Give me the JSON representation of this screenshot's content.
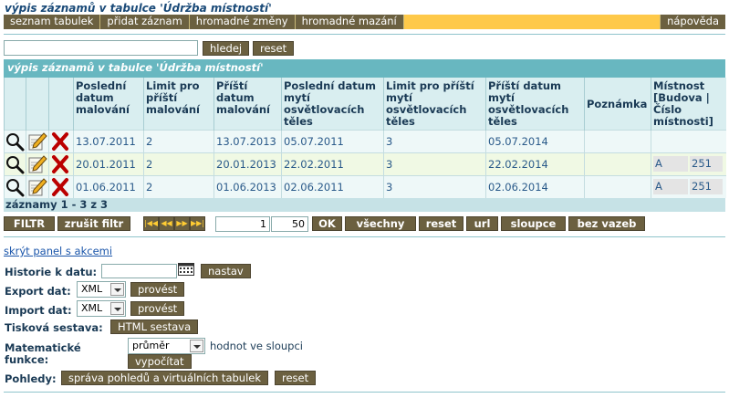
{
  "page_title": "výpis záznamů v tabulce 'Údržba místností'",
  "topbar": {
    "items": [
      "seznam tabulek",
      "přidat záznam",
      "hromadné změny",
      "hromadné mazání"
    ],
    "help": "nápověda"
  },
  "search": {
    "value": "",
    "button": "hledej",
    "reset": "reset"
  },
  "panel_title": "výpis záznamů v tabulce 'Údržba místností'",
  "table": {
    "headers": [
      "Poslední datum malování",
      "Limit pro příští malování",
      "Příští datum malování",
      "Poslední datum mytí osvětlovacích těles",
      "Limit pro příští mytí osvětlovacích těles",
      "Příští datum mytí osvětlovacích těles",
      "Poznámka",
      "Místnost [Budova | Číslo místnosti]"
    ],
    "rows": [
      [
        "13.07.2011",
        "2",
        "13.07.2013",
        "05.07.2011",
        "3",
        "05.07.2014",
        "",
        "",
        ""
      ],
      [
        "20.01.2011",
        "2",
        "20.01.2013",
        "22.02.2011",
        "3",
        "22.02.2014",
        "",
        "A",
        "251"
      ],
      [
        "01.06.2011",
        "2",
        "01.06.2013",
        "02.06.2011",
        "3",
        "02.06.2014",
        "",
        "A",
        "251"
      ]
    ],
    "records": "záznamy 1 - 3 z 3"
  },
  "icons": {
    "view": "magnifier-icon",
    "edit": "pencil-icon",
    "delete": "red-x-icon"
  },
  "toolbar": {
    "filter": "FILTR",
    "clear_filter": "zrušit filtr",
    "page_from": "1",
    "page_size": "50",
    "ok": "OK",
    "all": "všechny",
    "reset": "reset",
    "url": "url",
    "columns": "sloupce",
    "no_links": "bez vazeb"
  },
  "actions": {
    "hide_panel": "skrýt panel s akcemi",
    "history_label": "Historie k datu:",
    "history_value": "",
    "set": "nastav",
    "export_label": "Export dat:",
    "export_format": "XML",
    "run": "provést",
    "import_label": "Import dat:",
    "import_format": "XML",
    "print_label": "Tisková sestava:",
    "html_report": "HTML sestava",
    "math_label_1": "Matematické",
    "math_label_2": "funkce:",
    "math_function": "průměr",
    "math_suffix": "hodnot ve sloupci",
    "compute": "vypočítat",
    "views_label": "Pohledy:",
    "manage_views": "správa pohledů a virtuálních tabulek",
    "views_reset": "reset"
  },
  "colors": {
    "topbar": "#fec949",
    "button": "#6b6040",
    "panel_header": "#68b7c0",
    "table_header": "#d9eef0"
  }
}
